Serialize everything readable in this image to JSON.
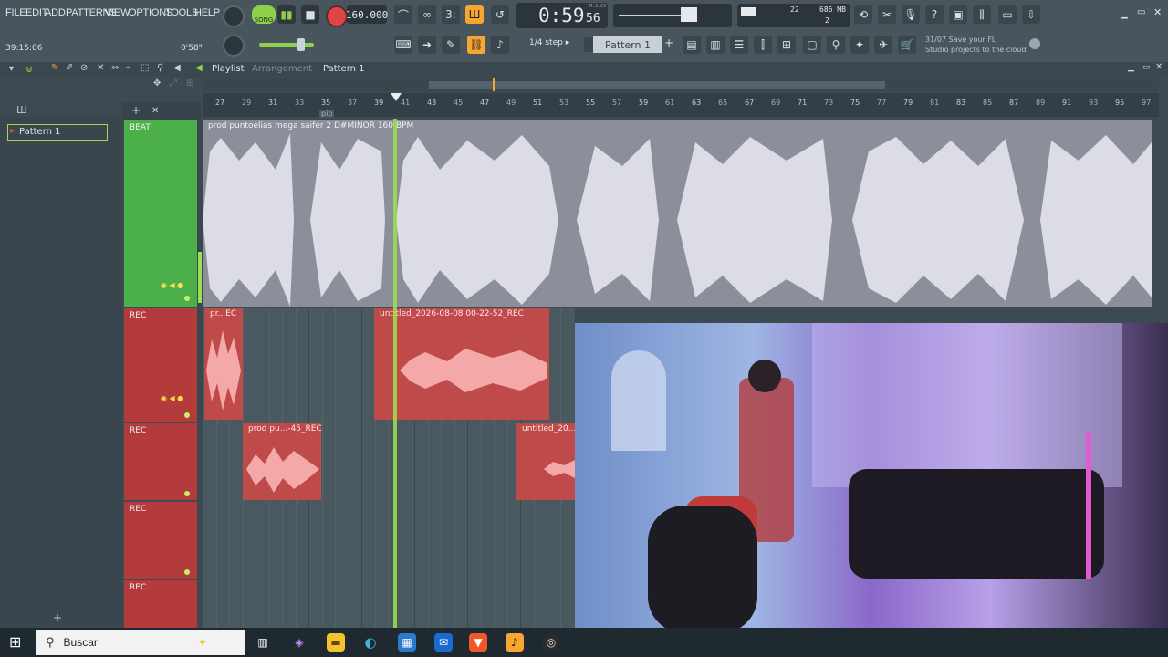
{
  "menu": [
    "FILE",
    "EDIT",
    "ADD",
    "PATTERNS",
    "VIEW",
    "OPTIONS",
    "TOOLS",
    "HELP"
  ],
  "transport": {
    "mode": "SONG",
    "tempo": "160.000",
    "time": "0:59",
    "time_small": "56",
    "time_unit": "M:S:CS",
    "position_left": "39:15:06",
    "position_right": "0'58\""
  },
  "monitor": {
    "memory": "686 MB",
    "cpu": "22",
    "poly": "2"
  },
  "snap": "1/4 step",
  "pattern": "Pattern 1",
  "hint": {
    "date": "31/07",
    "line1": "Save your FL",
    "line2": "Studio projects to the cloud"
  },
  "playlist": {
    "title": "Playlist",
    "sub": "Arrangement",
    "pattern": "Pattern 1",
    "pip": "pip"
  },
  "ruler": [
    "27",
    "29",
    "31",
    "33",
    "35",
    "37",
    "39",
    "41",
    "43",
    "45",
    "47",
    "49",
    "51",
    "53",
    "55",
    "57",
    "59",
    "61",
    "63",
    "65",
    "67",
    "69",
    "71",
    "73",
    "75",
    "77",
    "79",
    "81",
    "83",
    "85",
    "87",
    "89",
    "91",
    "93",
    "95",
    "97"
  ],
  "pattern_list": [
    "Pattern 1"
  ],
  "tracks": [
    {
      "label": "BEAT",
      "color": "#4cb04a"
    },
    {
      "label": "REC",
      "color": "#b33b3b"
    },
    {
      "label": "REC",
      "color": "#b33b3b"
    },
    {
      "label": "REC",
      "color": "#b33b3b"
    },
    {
      "label": "REC",
      "color": "#b33b3b"
    }
  ],
  "clips": {
    "beat": "prod puntoelias mega saifer 2 D#MINOR 160 BPM",
    "rec1a": "pr...EC",
    "rec1b": "untitled_2026-08-08 00-22-52_REC",
    "rec2a": "prod pu...-45_REC",
    "rec2b": "untitled_20..."
  },
  "taskbar": {
    "search_placeholder": "Buscar"
  },
  "colors": {
    "accent": "#f7a630",
    "beat": "#4cb04a",
    "rec": "#b33b3b",
    "clip_rec": "#bf4a4a",
    "playhead": "#9be050"
  }
}
